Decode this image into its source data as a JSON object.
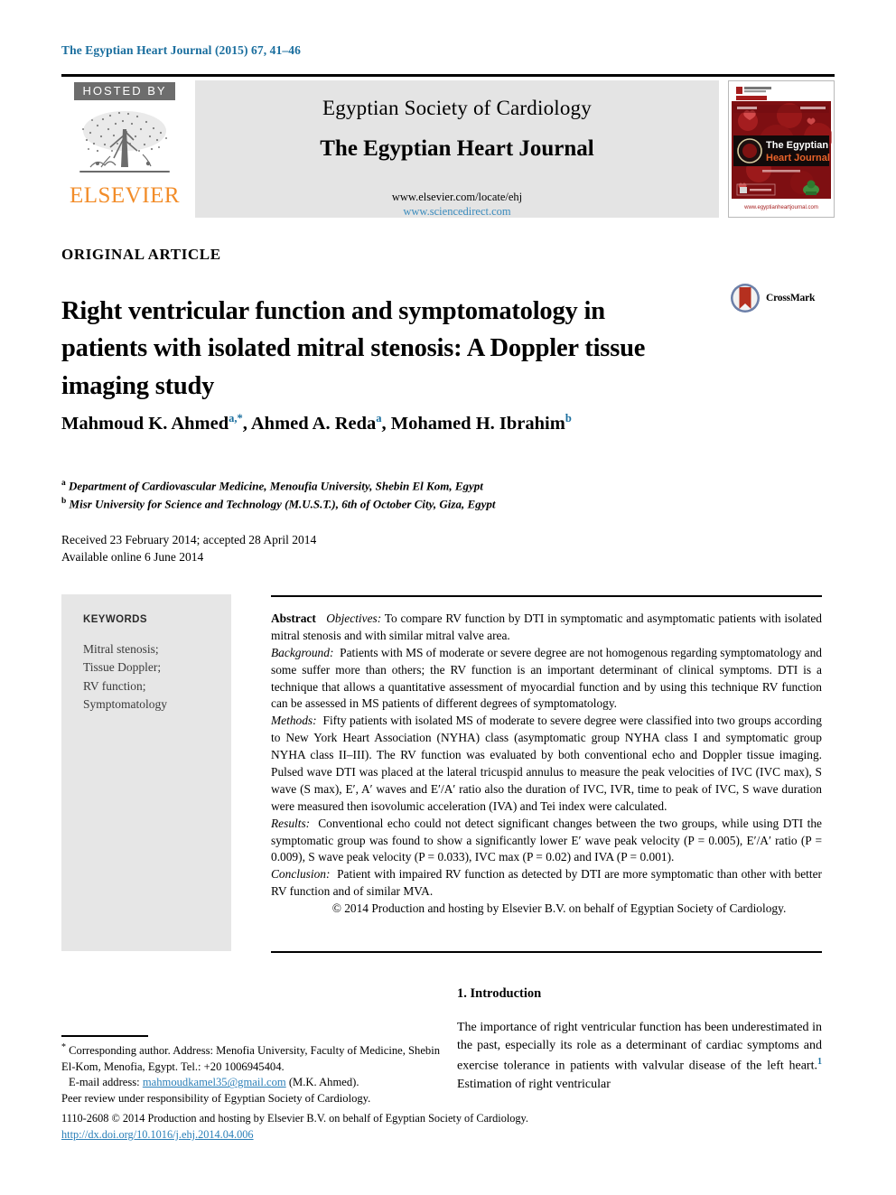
{
  "running_head": "The Egyptian Heart Journal (2015) 67, 41–46",
  "masthead": {
    "hosted_by_label": "HOSTED BY",
    "publisher_name": "ELSEVIER",
    "publisher_logo_icon": "elsevier-tree-icon",
    "society_name": "Egyptian Society of Cardiology",
    "journal_name": "The Egyptian Heart Journal",
    "url_elsevier": "www.elsevier.com/locate/ehj",
    "url_sciencedirect": "www.sciencedirect.com",
    "cover_icon": "journal-cover-thumbnail",
    "cover_journal_line1": "The Egyptian",
    "cover_journal_line2": "Heart Journal"
  },
  "article": {
    "type": "ORIGINAL ARTICLE",
    "title": "Right ventricular function and symptomatology in patients with isolated mitral stenosis: A Doppler tissue imaging study",
    "crossmark_label": "CrossMark",
    "crossmark_icon": "crossmark-icon",
    "authors": [
      {
        "name": "Mahmoud K. Ahmed",
        "marks": "a,*"
      },
      {
        "name": "Ahmed A. Reda",
        "marks": "a"
      },
      {
        "name": "Mohamed H. Ibrahim",
        "marks": "b"
      }
    ],
    "affiliations": [
      {
        "mark": "a",
        "text": "Department of Cardiovascular Medicine, Menoufia University, Shebin El Kom, Egypt"
      },
      {
        "mark": "b",
        "text": "Misr University for Science and Technology (M.U.S.T.), 6th of October City, Giza, Egypt"
      }
    ],
    "received_line": "Received 23 February 2014; accepted 28 April 2014",
    "available_line": "Available online 6 June 2014"
  },
  "keywords": {
    "heading": "KEYWORDS",
    "items": "Mitral stenosis; Tissue Doppler; RV function; Symptomatology",
    "list": [
      "Mitral stenosis;",
      "Tissue Doppler;",
      "RV function;",
      "Symptomatology"
    ]
  },
  "abstract": {
    "label": "Abstract",
    "objectives_label": "Objectives:",
    "objectives_text": "To compare RV function by DTI in symptomatic and asymptomatic patients with isolated mitral stenosis and with similar mitral valve area.",
    "background_label": "Background:",
    "background_text": "Patients with MS of moderate or severe degree are not homogenous regarding symptomatology and some suffer more than others; the RV function is an important determinant of clinical symptoms. DTI is a technique that allows a quantitative assessment of myocardial function and by using this technique RV function can be assessed in MS patients of different degrees of symptomatology.",
    "methods_label": "Methods:",
    "methods_text": "Fifty patients with isolated MS of moderate to severe degree were classified into two groups according to New York Heart Association (NYHA) class (asymptomatic group NYHA class I and symptomatic group NYHA class II–III). The RV function was evaluated by both conventional echo and Doppler tissue imaging. Pulsed wave DTI was placed at the lateral tricuspid annulus to measure the peak velocities of IVC (IVC max), S wave (S max), E′, A′ waves and E′/A′ ratio also the duration of IVC, IVR, time to peak of IVC, S wave duration were measured then isovolumic acceleration (IVA) and Tei index were calculated.",
    "results_label": "Results:",
    "results_text": "Conventional echo could not detect significant changes between the two groups, while using DTI the symptomatic group was found to show a significantly lower E′ wave peak velocity (P = 0.005), E′/A′ ratio (P = 0.009), S wave peak velocity (P = 0.033), IVC max (P = 0.02) and IVA (P = 0.001).",
    "conclusion_label": "Conclusion:",
    "conclusion_text": "Patient with impaired RV function as detected by DTI are more symptomatic than other with better RV function and of similar MVA.",
    "copyright": "© 2014 Production and hosting by Elsevier B.V. on behalf of Egyptian Society of Cardiology."
  },
  "introduction": {
    "heading": "1. Introduction",
    "paragraph_part1": "The importance of right ventricular function has been underestimated in the past, especially its role as a determinant of cardiac symptoms and exercise tolerance in patients with valvular disease of the left heart.",
    "reference_number": "1",
    "paragraph_part2": " Estimation of right ventricular"
  },
  "footnotes": {
    "corresponding": "Corresponding author. Address: Menofia University, Faculty of Medicine, Shebin El-Kom, Menofia, Egypt. Tel.: +20 1006945404.",
    "email_label": "E-mail address:",
    "email": "mahmoudkamel35@gmail.com",
    "email_suffix": "(M.K. Ahmed).",
    "peer_review": "Peer review under responsibility of Egyptian Society of Cardiology."
  },
  "imprint": {
    "line": "1110-2608 © 2014 Production and hosting by Elsevier B.V. on behalf of Egyptian Society of Cardiology.",
    "doi": "http://dx.doi.org/10.1016/j.ehj.2014.04.006"
  },
  "colors": {
    "accent_blue": "#1a6e9e",
    "link_blue": "#2a7fb8",
    "elsevier_orange": "#f28c28",
    "panel_gray": "#e4e4e4",
    "keyword_panel_gray": "#e6e6e6"
  }
}
